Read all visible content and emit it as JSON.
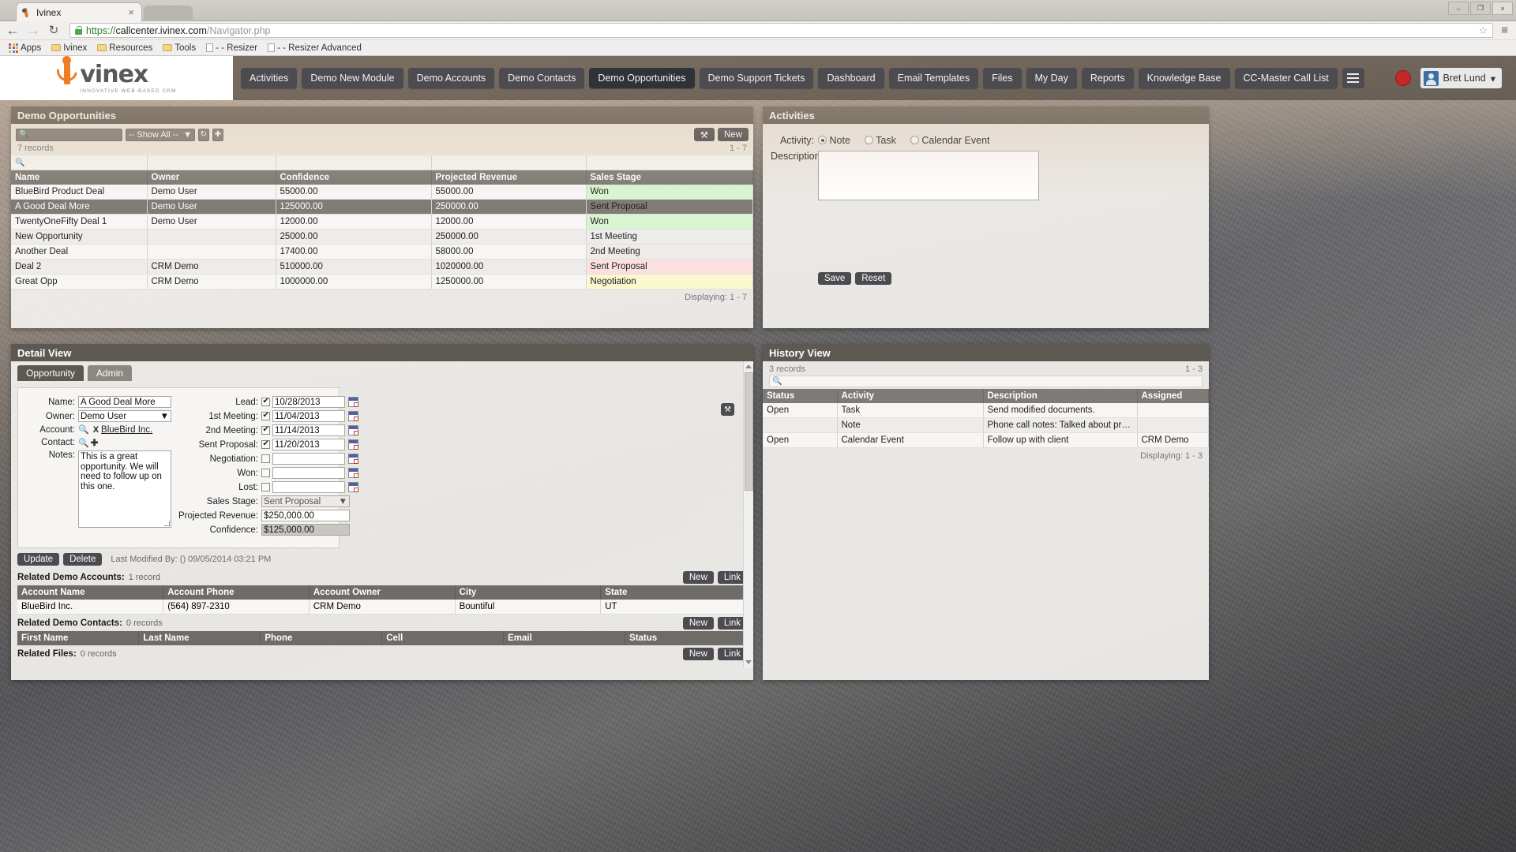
{
  "browser": {
    "tab_title": "Ivinex",
    "tab_close": "×",
    "back": "←",
    "forward": "→",
    "reload": "↻",
    "url_scheme": "https://",
    "url_domain": "callcenter.ivinex.com",
    "url_path": "/Navigator.php",
    "star": "☆",
    "menu": "≡",
    "win_min": "–",
    "win_max": "❐",
    "win_close": "×",
    "bookmarks": [
      {
        "label": "Apps",
        "icon": "apps-grid-icon"
      },
      {
        "label": "Ivinex",
        "icon": "folder-icon"
      },
      {
        "label": "Resources",
        "icon": "folder-icon"
      },
      {
        "label": "Tools",
        "icon": "folder-icon"
      },
      {
        "label": "- - Resizer",
        "icon": "page-icon"
      },
      {
        "label": "- - Resizer Advanced",
        "icon": "page-icon"
      }
    ]
  },
  "header": {
    "logo_word": "vinex",
    "logo_tagline": "INNOVATIVE WEB-BASED CRM",
    "nav": [
      {
        "label": "Activities",
        "active": false
      },
      {
        "label": "Demo New Module",
        "active": false
      },
      {
        "label": "Demo Accounts",
        "active": false
      },
      {
        "label": "Demo Contacts",
        "active": false
      },
      {
        "label": "Demo Opportunities",
        "active": true
      },
      {
        "label": "Demo Support Tickets",
        "active": false
      },
      {
        "label": "Dashboard",
        "active": false
      },
      {
        "label": "Email Templates",
        "active": false
      },
      {
        "label": "Files",
        "active": false
      },
      {
        "label": "My Day",
        "active": false
      },
      {
        "label": "Reports",
        "active": false
      },
      {
        "label": "Knowledge Base",
        "active": false
      },
      {
        "label": "CC-Master Call List",
        "active": false
      }
    ],
    "user_name": "Bret Lund",
    "user_caret": "▾"
  },
  "opportunities": {
    "panel_title": "Demo Opportunities",
    "search_placeholder": "",
    "filter_label": "-- Show All --",
    "filter_caret": "▼",
    "refresh_icon": "↻",
    "add_icon": "✚",
    "wrench_icon": "⚒",
    "new_label": "New",
    "record_count": "7 records",
    "range": "1 - 7",
    "displaying": "Displaying: 1 - 7",
    "columns": [
      "Name",
      "Owner",
      "Confidence",
      "Projected Revenue",
      "Sales Stage"
    ],
    "rows": [
      {
        "name": "BlueBird Product Deal",
        "owner": "Demo User",
        "confidence": "55000.00",
        "revenue": "55000.00",
        "stage": "Won",
        "stage_style": "st-won",
        "selected": false
      },
      {
        "name": "A Good Deal More",
        "owner": "Demo User",
        "confidence": "125000.00",
        "revenue": "250000.00",
        "stage": "Sent Proposal",
        "stage_style": "st-prop",
        "selected": true
      },
      {
        "name": "TwentyOneFifty Deal 1",
        "owner": "Demo User",
        "confidence": "12000.00",
        "revenue": "12000.00",
        "stage": "Won",
        "stage_style": "st-won",
        "selected": false
      },
      {
        "name": "New Opportunity",
        "owner": "",
        "confidence": "25000.00",
        "revenue": "250000.00",
        "stage": "1st Meeting",
        "stage_style": "st-neut",
        "selected": false
      },
      {
        "name": "Another Deal",
        "owner": "",
        "confidence": "17400.00",
        "revenue": "58000.00",
        "stage": "2nd Meeting",
        "stage_style": "st-neut",
        "selected": false
      },
      {
        "name": "Deal 2",
        "owner": "CRM Demo",
        "confidence": "510000.00",
        "revenue": "1020000.00",
        "stage": "Sent Proposal",
        "stage_style": "st-prop",
        "selected": false
      },
      {
        "name": "Great Opp",
        "owner": "CRM Demo",
        "confidence": "1000000.00",
        "revenue": "1250000.00",
        "stage": "Negotiation",
        "stage_style": "st-neg",
        "selected": false
      }
    ]
  },
  "activities": {
    "panel_title": "Activities",
    "activity_label": "Activity:",
    "options": [
      {
        "label": "Note",
        "selected": true
      },
      {
        "label": "Task",
        "selected": false
      },
      {
        "label": "Calendar Event",
        "selected": false
      }
    ],
    "description_label": "Description:",
    "description_value": "",
    "save_label": "Save",
    "reset_label": "Reset"
  },
  "detail": {
    "panel_title": "Detail View",
    "tabs": [
      {
        "label": "Opportunity",
        "active": true
      },
      {
        "label": "Admin",
        "active": false
      }
    ],
    "wrench_icon": "⚒",
    "fields": {
      "name_label": "Name:",
      "name_value": "A Good Deal More",
      "owner_label": "Owner:",
      "owner_value": "Demo User",
      "account_label": "Account:",
      "account_value": "BlueBird Inc.",
      "account_clear": "X",
      "contact_label": "Contact:",
      "contact_value": "",
      "notes_label": "Notes:",
      "notes_value": "This is a great opportunity. We will need to follow up on this one."
    },
    "milestones": [
      {
        "label": "Lead:",
        "checked": true,
        "date": "10/28/2013"
      },
      {
        "label": "1st Meeting:",
        "checked": true,
        "date": "11/04/2013"
      },
      {
        "label": "2nd Meeting:",
        "checked": true,
        "date": "11/14/2013"
      },
      {
        "label": "Sent Proposal:",
        "checked": true,
        "date": "11/20/2013"
      },
      {
        "label": "Negotiation:",
        "checked": false,
        "date": ""
      },
      {
        "label": "Won:",
        "checked": false,
        "date": ""
      },
      {
        "label": "Lost:",
        "checked": false,
        "date": ""
      }
    ],
    "sales_stage_label": "Sales Stage:",
    "sales_stage_value": "Sent Proposal",
    "projected_revenue_label": "Projected Revenue:",
    "projected_revenue_value": "$250,000.00",
    "confidence_label": "Confidence:",
    "confidence_value": "$125,000.00",
    "update_label": "Update",
    "delete_label": "Delete",
    "last_modified": "Last Modified By: () 09/05/2014 03:21 PM",
    "related": [
      {
        "title": "Related Demo Accounts:",
        "count": "1 record",
        "new_label": "New",
        "link_label": "Link",
        "columns": [
          "Account Name",
          "Account Phone",
          "Account Owner",
          "City",
          "State"
        ],
        "rows": [
          [
            "BlueBird Inc.",
            "(564) 897-2310",
            "CRM Demo",
            "Bountiful",
            "UT"
          ]
        ]
      },
      {
        "title": "Related Demo Contacts:",
        "count": "0 records",
        "new_label": "New",
        "link_label": "Link",
        "columns": [
          "First Name",
          "Last Name",
          "Phone",
          "Cell",
          "Email",
          "Status"
        ],
        "rows": []
      },
      {
        "title": "Related Files:",
        "count": "0 records",
        "new_label": "New",
        "link_label": "Link",
        "columns": [],
        "rows": []
      }
    ]
  },
  "history": {
    "panel_title": "History View",
    "record_count": "3 records",
    "range": "1 - 3",
    "displaying": "Displaying: 1 - 3",
    "columns": [
      "Status",
      "Activity",
      "Description",
      "Assigned"
    ],
    "rows": [
      {
        "status": "Open",
        "activity": "Task",
        "description": "Send modified documents.",
        "assigned": ""
      },
      {
        "status": "",
        "activity": "Note",
        "description": "Phone call notes: Talked about proposal an",
        "assigned": ""
      },
      {
        "status": "Open",
        "activity": "Calendar Event",
        "description": "Follow up with client",
        "assigned": "CRM Demo"
      }
    ]
  }
}
